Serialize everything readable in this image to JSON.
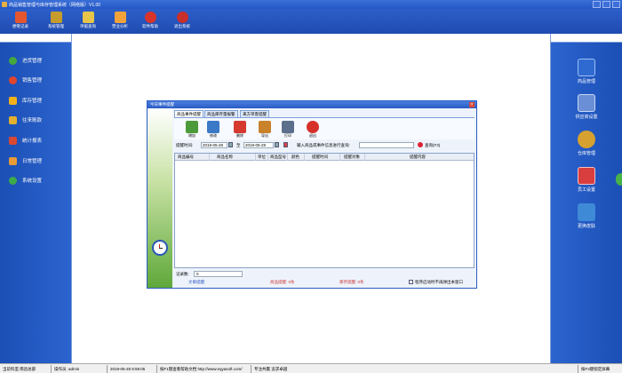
{
  "window": {
    "title": "商品销售管理与库存管理系统（网络版）V1.00"
  },
  "toolbar": {
    "items": [
      {
        "label": "便笺记录",
        "icon": "notepad-icon",
        "color": "#e4572e"
      },
      {
        "label": "系统管理",
        "icon": "sitemap-icon",
        "color": "#c69c2c"
      },
      {
        "label": "单据查询",
        "icon": "magnifier-icon",
        "color": "#e8c54a"
      },
      {
        "label": "营业分析",
        "icon": "bar-chart-icon",
        "color": "#f1a33a"
      },
      {
        "label": "软件帮助",
        "icon": "help-icon",
        "color": "#d9342b"
      },
      {
        "label": "退出系统",
        "icon": "power-icon",
        "color": "#c9302c"
      }
    ]
  },
  "leftnav": {
    "items": [
      {
        "label": "进货管理",
        "icon": "plus-icon",
        "color": "#45a83f"
      },
      {
        "label": "销售管理",
        "icon": "pie-chart-icon",
        "color": "#e0452e"
      },
      {
        "label": "库存管理",
        "icon": "star-icon",
        "color": "#f3b21a"
      },
      {
        "label": "往来账款",
        "icon": "money-icon",
        "color": "#e3b02f"
      },
      {
        "label": "统计报表",
        "icon": "bar-chart-icon",
        "color": "#d94832"
      },
      {
        "label": "日常管理",
        "icon": "briefcase-icon",
        "color": "#e79a35"
      },
      {
        "label": "系统设置",
        "icon": "gear-icon",
        "color": "#3eaa49"
      }
    ]
  },
  "rightnav": {
    "items": [
      {
        "label": "商品管理",
        "icon": "computer-icon",
        "color": "#2f6ad0"
      },
      {
        "label": "供应商设置",
        "icon": "people-icon",
        "color": "#6a8fd6"
      },
      {
        "label": "仓库管理",
        "icon": "gear-icon",
        "color": "#d6a12f"
      },
      {
        "label": "员工设置",
        "icon": "user-card-icon",
        "color": "#d83e3e"
      },
      {
        "label": "更换皮肤",
        "icon": "cubes-icon",
        "color": "#3e8ad7"
      }
    ]
  },
  "dialog": {
    "title": "今日事件提醒",
    "tabs": [
      "商品事件提醒",
      "商品库存量报警",
      "来方单客提醒"
    ],
    "buttons": [
      {
        "label": "增加",
        "icon": "add-icon",
        "color": "#4c9b3a"
      },
      {
        "label": "修改",
        "icon": "edit-icon",
        "color": "#3b79c7"
      },
      {
        "label": "删除",
        "icon": "delete-icon",
        "color": "#d63a2f"
      },
      {
        "label": "导出",
        "icon": "export-icon",
        "color": "#c9812a"
      },
      {
        "label": "打印",
        "icon": "printer-icon",
        "color": "#5c6f8c"
      },
      {
        "label": "退出",
        "icon": "exit-icon",
        "color": "#d6302a"
      }
    ],
    "filter": {
      "time_label": "提醒时间:",
      "date_from": "2019-05-28",
      "to_label": "至",
      "date_to": "2019-05-28",
      "keyword_label": "输入商品或事件信息进行查询:",
      "keyword_value": "",
      "search_label": "查询(F3)"
    },
    "columns": [
      "商品编号",
      "商品名称",
      "单位",
      "商品型号",
      "颜色",
      "提醒时间",
      "提醒对象",
      "提醒内容"
    ],
    "count_label": "记录数:",
    "count_value": "0",
    "footer": {
      "item1": "文章提醒:",
      "item2": "商品提醒: 0条",
      "item3": "库存提醒: 0条",
      "checkbox_label": "程序启动时不再弹出本窗口"
    }
  },
  "statusbar": {
    "dept": "当前科室:南昌总部",
    "operator": "操作员: admin",
    "datetime": "2019-05-28 8:59:05",
    "help": "按F1键查看帮助文档 http://www.eqyasoft.com/",
    "slogan": "专注共赢 追求卓越",
    "lock": "按F3键锁定屏幕"
  }
}
